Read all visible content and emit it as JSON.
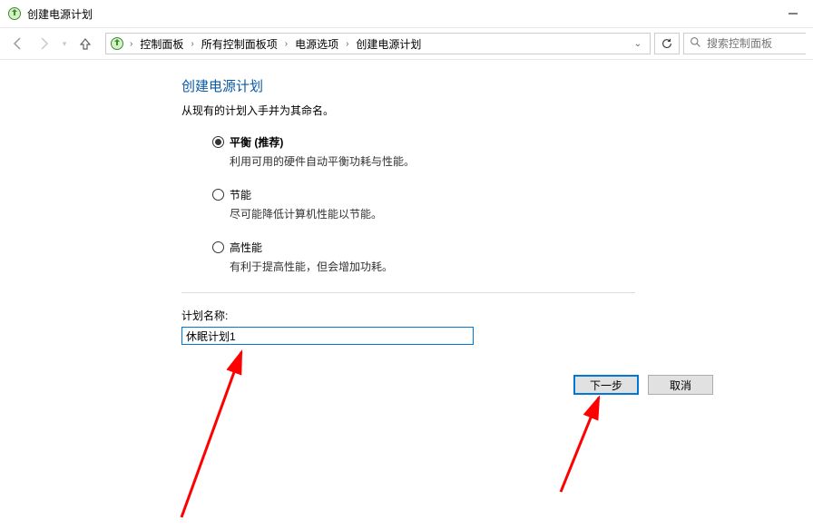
{
  "window": {
    "title": "创建电源计划"
  },
  "breadcrumb": {
    "items": [
      "控制面板",
      "所有控制面板项",
      "电源选项",
      "创建电源计划"
    ]
  },
  "search": {
    "placeholder": "搜索控制面板"
  },
  "page": {
    "heading": "创建电源计划",
    "subhead": "从现有的计划入手并为其命名。"
  },
  "options": [
    {
      "label": "平衡 (推荐)",
      "desc": "利用可用的硬件自动平衡功耗与性能。",
      "checked": true,
      "bold": true
    },
    {
      "label": "节能",
      "desc": "尽可能降低计算机性能以节能。",
      "checked": false,
      "bold": false
    },
    {
      "label": "高性能",
      "desc": "有利于提高性能，但会增加功耗。",
      "checked": false,
      "bold": false
    }
  ],
  "plan": {
    "label": "计划名称:",
    "value": "休眠计划1"
  },
  "footer": {
    "next": "下一步",
    "cancel": "取消"
  }
}
